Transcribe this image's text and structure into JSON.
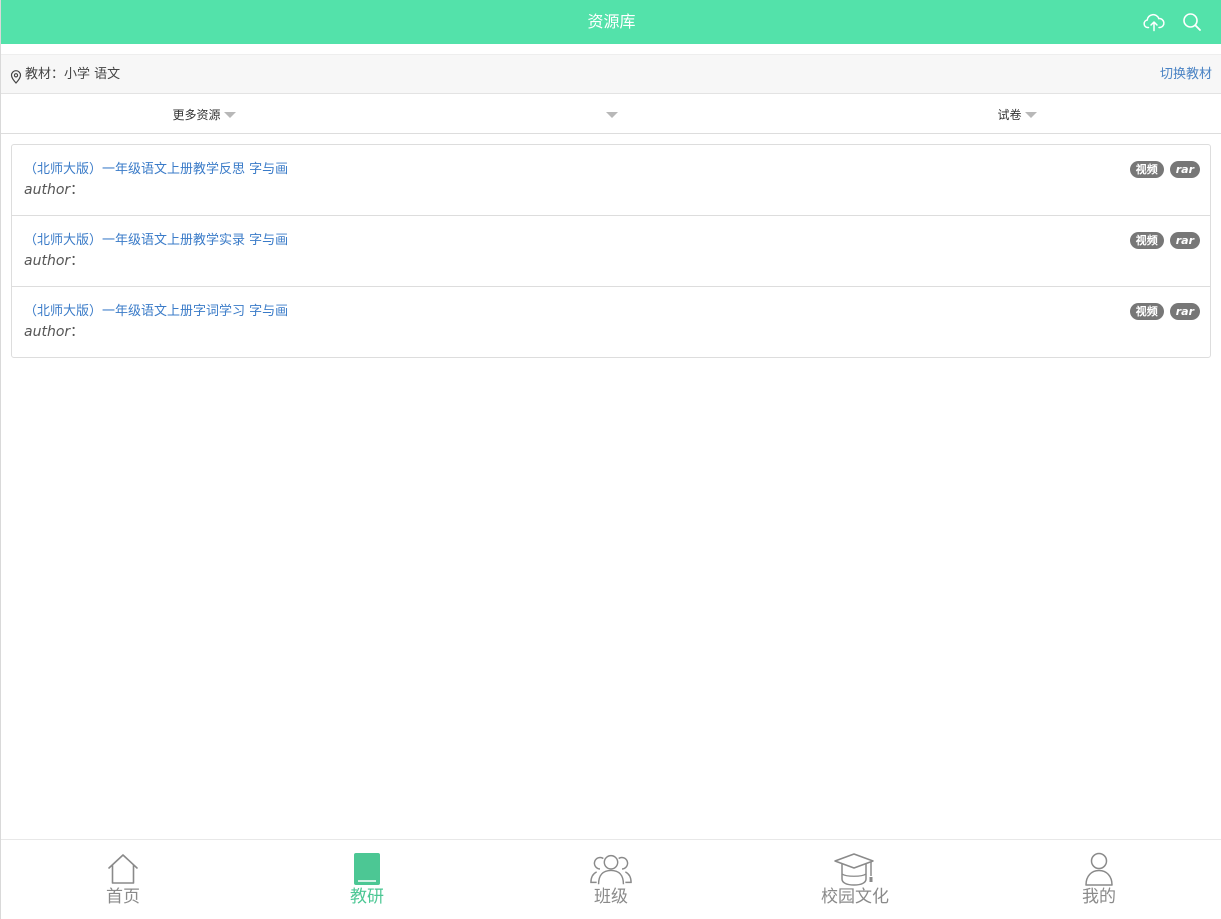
{
  "header": {
    "title": "资源库",
    "icons": [
      "cloud-upload-icon",
      "search-icon"
    ],
    "accent_color": "#53e2aa"
  },
  "textbook_bar": {
    "text": "教材：小学 语文",
    "switch_label": "切换教材"
  },
  "filters": [
    {
      "label": "更多资源"
    },
    {
      "label": ""
    },
    {
      "label": "试卷"
    }
  ],
  "resources": [
    {
      "title": "（北师大版）一年级语文上册教学反思 字与画",
      "author_label": "author",
      "author_sep": "：",
      "badges": [
        "视频",
        "rar"
      ]
    },
    {
      "title": "（北师大版）一年级语文上册教学实录 字与画",
      "author_label": "author",
      "author_sep": "：",
      "badges": [
        "视频",
        "rar"
      ]
    },
    {
      "title": "（北师大版）一年级语文上册字词学习 字与画",
      "author_label": "author",
      "author_sep": "：",
      "badges": [
        "视频",
        "rar"
      ]
    }
  ],
  "tabbar": {
    "active_color": "#4cc794",
    "tabs": [
      {
        "label": "首页",
        "icon": "home-icon"
      },
      {
        "label": "教研",
        "icon": "book-icon",
        "active": true
      },
      {
        "label": "班级",
        "icon": "group-icon"
      },
      {
        "label": "校园文化",
        "icon": "graduation-cap-icon"
      },
      {
        "label": "我的",
        "icon": "user-icon"
      }
    ]
  }
}
